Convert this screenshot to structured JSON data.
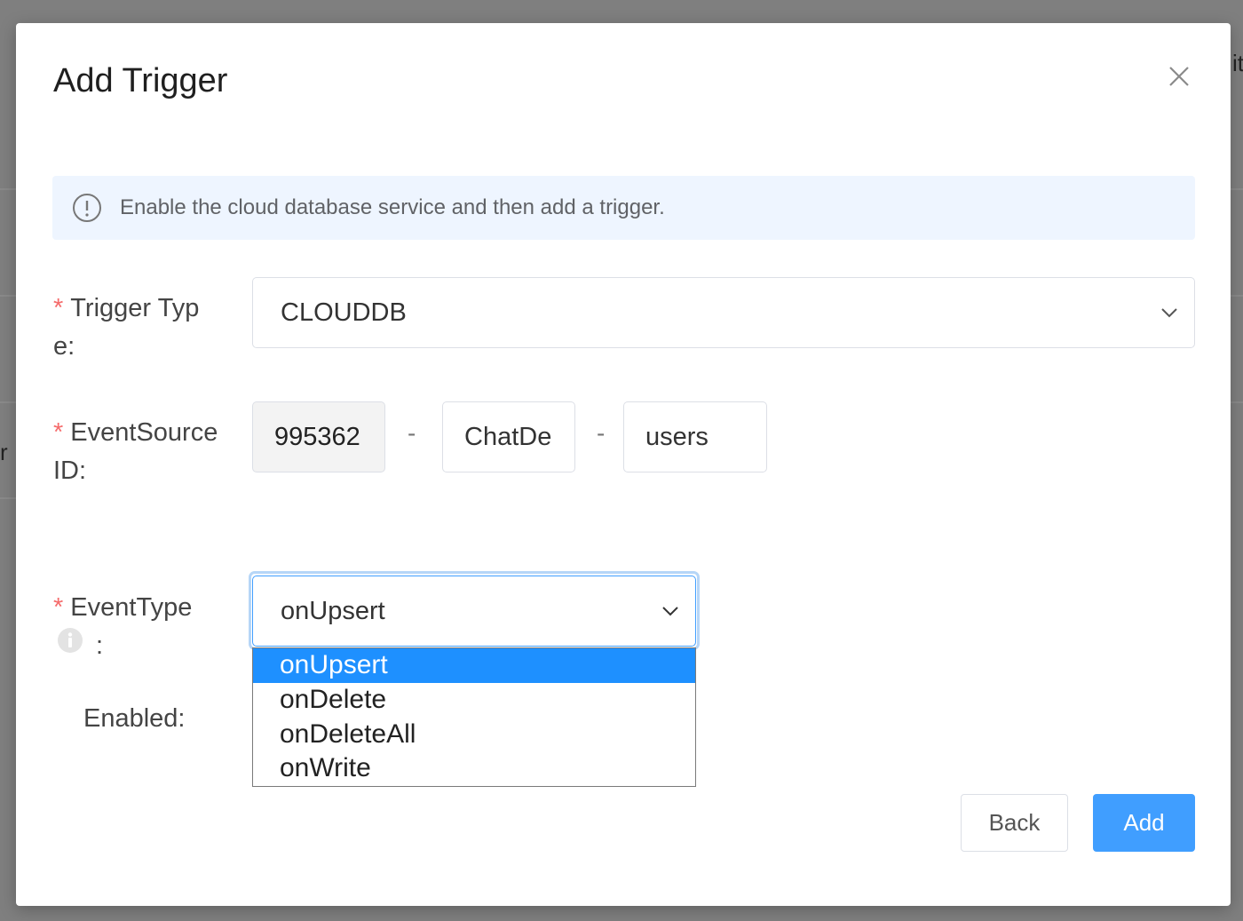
{
  "dialog": {
    "title": "Add Trigger",
    "alert_text": "Enable the cloud database service and then add a trigger."
  },
  "form": {
    "required_mark": "*",
    "trigger_type": {
      "label_line1": "Trigger Typ",
      "label_line2": "e:",
      "value": "CLOUDDB"
    },
    "event_source": {
      "label_line1": "EventSource",
      "label_line2": "ID:",
      "project_id": "995362",
      "database": "ChatDe",
      "collection": "users",
      "separator": "-"
    },
    "event_type": {
      "label": "EventType",
      "colon": ":",
      "value": "onUpsert",
      "options": [
        "onUpsert",
        "onDelete",
        "onDeleteAll",
        "onWrite"
      ],
      "selected_index": 0
    },
    "enabled": {
      "label": "Enabled:"
    }
  },
  "buttons": {
    "back": "Back",
    "add": "Add"
  },
  "background": {
    "edge_char_right": "it",
    "edge_char_left": "r"
  },
  "colors": {
    "primary": "#409eff",
    "selected_option": "#1e90ff",
    "required": "#f56c6c",
    "alert_bg": "#eef5ff"
  }
}
